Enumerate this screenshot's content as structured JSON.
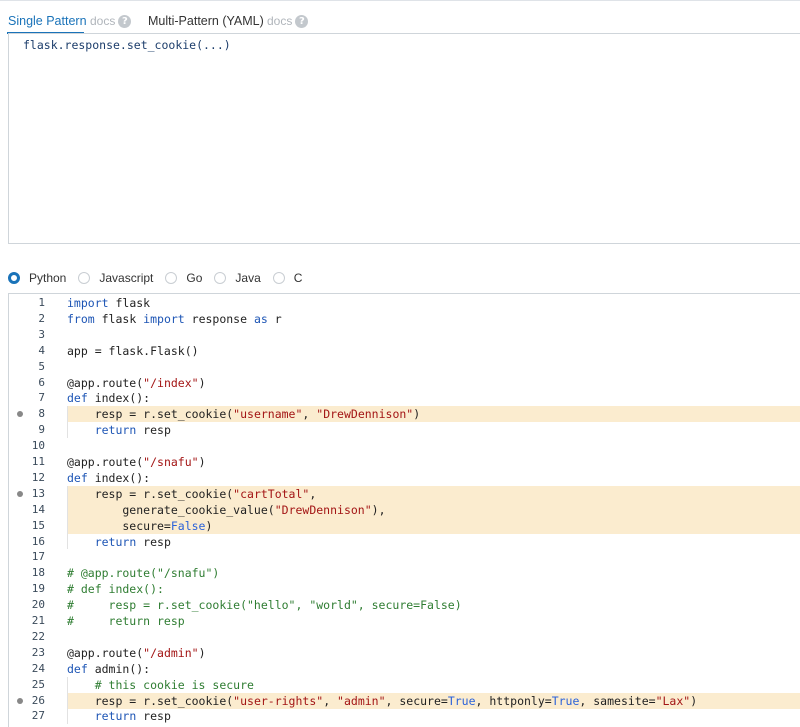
{
  "tabs": {
    "single_pattern": "Single Pattern",
    "docs1": "docs",
    "multi_pattern": "Multi-Pattern (YAML)",
    "docs2": "docs",
    "help_glyph": "?"
  },
  "pattern": {
    "text": "flask.response.set_cookie(...)"
  },
  "languages": [
    {
      "label": "Python",
      "selected": true
    },
    {
      "label": "Javascript",
      "selected": false
    },
    {
      "label": "Go",
      "selected": false
    },
    {
      "label": "Java",
      "selected": false
    },
    {
      "label": "C",
      "selected": false
    }
  ],
  "colors": {
    "accent": "#1a73b9",
    "highlight": "#fbeccf",
    "keyword": "#1d55b5",
    "string": "#a31515",
    "comment": "#2f7d32"
  },
  "code": {
    "lines": [
      {
        "n": "1",
        "text": "import flask",
        "hl": false,
        "marker": false
      },
      {
        "n": "2",
        "text": "from flask import response as r",
        "hl": false,
        "marker": false
      },
      {
        "n": "3",
        "text": "",
        "hl": false,
        "marker": false
      },
      {
        "n": "4",
        "text": "app = flask.Flask()",
        "hl": false,
        "marker": false
      },
      {
        "n": "5",
        "text": "",
        "hl": false,
        "marker": false
      },
      {
        "n": "6",
        "text": "@app.route(\"/index\")",
        "hl": false,
        "marker": false
      },
      {
        "n": "7",
        "text": "def index():",
        "hl": false,
        "marker": false
      },
      {
        "n": "8",
        "text": "    resp = r.set_cookie(\"username\", \"DrewDennison\")",
        "hl": true,
        "marker": true
      },
      {
        "n": "9",
        "text": "    return resp",
        "hl": false,
        "marker": false
      },
      {
        "n": "10",
        "text": "",
        "hl": false,
        "marker": false
      },
      {
        "n": "11",
        "text": "@app.route(\"/snafu\")",
        "hl": false,
        "marker": false
      },
      {
        "n": "12",
        "text": "def index():",
        "hl": false,
        "marker": false
      },
      {
        "n": "13",
        "text": "    resp = r.set_cookie(\"cartTotal\",",
        "hl": true,
        "marker": true
      },
      {
        "n": "14",
        "text": "        generate_cookie_value(\"DrewDennison\"),",
        "hl": true,
        "marker": false
      },
      {
        "n": "15",
        "text": "        secure=False)",
        "hl": true,
        "marker": false
      },
      {
        "n": "16",
        "text": "    return resp",
        "hl": false,
        "marker": false
      },
      {
        "n": "17",
        "text": "",
        "hl": false,
        "marker": false
      },
      {
        "n": "18",
        "text": "# @app.route(\"/snafu\")",
        "hl": false,
        "marker": false
      },
      {
        "n": "19",
        "text": "# def index():",
        "hl": false,
        "marker": false
      },
      {
        "n": "20",
        "text": "#     resp = r.set_cookie(\"hello\", \"world\", secure=False)",
        "hl": false,
        "marker": false
      },
      {
        "n": "21",
        "text": "#     return resp",
        "hl": false,
        "marker": false
      },
      {
        "n": "22",
        "text": "",
        "hl": false,
        "marker": false
      },
      {
        "n": "23",
        "text": "@app.route(\"/admin\")",
        "hl": false,
        "marker": false
      },
      {
        "n": "24",
        "text": "def admin():",
        "hl": false,
        "marker": false
      },
      {
        "n": "25",
        "text": "    # this cookie is secure",
        "hl": false,
        "marker": false
      },
      {
        "n": "26",
        "text": "    resp = r.set_cookie(\"user-rights\", \"admin\", secure=True, httponly=True, samesite=\"Lax\")",
        "hl": true,
        "marker": true
      },
      {
        "n": "27",
        "text": "    return resp",
        "hl": false,
        "marker": false
      }
    ]
  }
}
